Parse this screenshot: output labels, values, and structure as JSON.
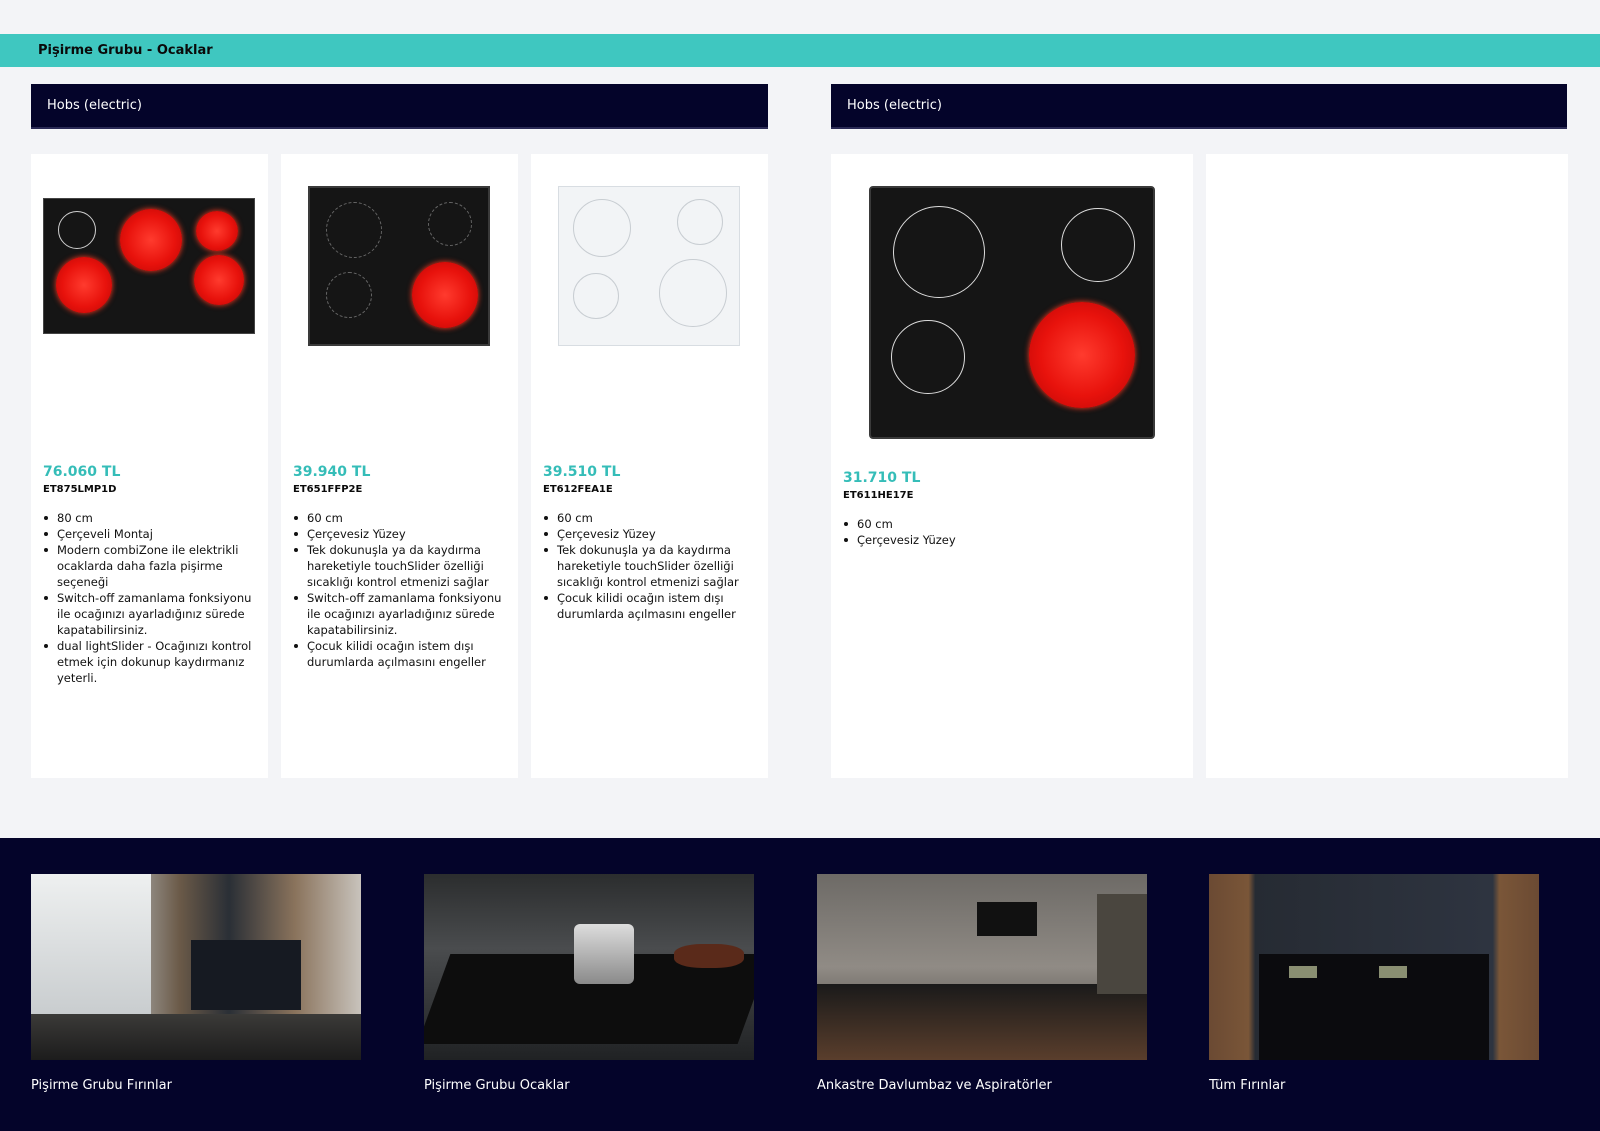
{
  "page": {
    "title": "Pişirme Grubu - Ocaklar"
  },
  "sections": [
    {
      "heading": "Hobs (electric)"
    },
    {
      "heading": "Hobs (electric)"
    }
  ],
  "products": [
    {
      "price": "76.060 TL",
      "model": "ET875LMP1D",
      "features": [
        "80 cm",
        "Çerçeveli Montaj",
        "Modern combiZone ile elektrikli ocaklarda daha fazla pişirme seçeneği",
        "Switch-off zamanlama fonksiyonu ile ocağınızı ayarladığınız sürede kapatabilirsiniz.",
        "dual lightSlider - Ocağınızı kontrol etmek için dokunup kaydırmanız yeterli."
      ]
    },
    {
      "price": "39.940 TL",
      "model": "ET651FFP2E",
      "features": [
        "60 cm",
        "Çerçevesiz Yüzey",
        "Tek dokunuşla ya da kaydırma hareketiyle touchSlider özelliği sıcaklığı kontrol etmenizi sağlar",
        "Switch-off zamanlama fonksiyonu ile ocağınızı ayarladığınız sürede kapatabilirsiniz.",
        "Çocuk kilidi ocağın istem dışı durumlarda açılmasını engeller"
      ]
    },
    {
      "price": "39.510 TL",
      "model": "ET612FEA1E",
      "features": [
        "60 cm",
        "Çerçevesiz Yüzey",
        "Tek dokunuşla ya da kaydırma hareketiyle touchSlider özelliği sıcaklığı kontrol etmenizi sağlar",
        "Çocuk kilidi ocağın istem dışı durumlarda açılmasını engeller"
      ]
    },
    {
      "price": "31.710 TL",
      "model": "ET611HE17E",
      "features": [
        "60 cm",
        "Çerçevesiz Yüzey"
      ]
    }
  ],
  "footer": {
    "tiles": [
      {
        "label": "Pişirme Grubu Fırınlar"
      },
      {
        "label": "Pişirme Grubu Ocaklar"
      },
      {
        "label": "Ankastre Davlumbaz ve Aspiratörler"
      },
      {
        "label": "Tüm Fırınlar"
      }
    ]
  },
  "colors": {
    "accent": "#3fc7c0",
    "price": "#35bdb8",
    "navy": "#04042a"
  }
}
